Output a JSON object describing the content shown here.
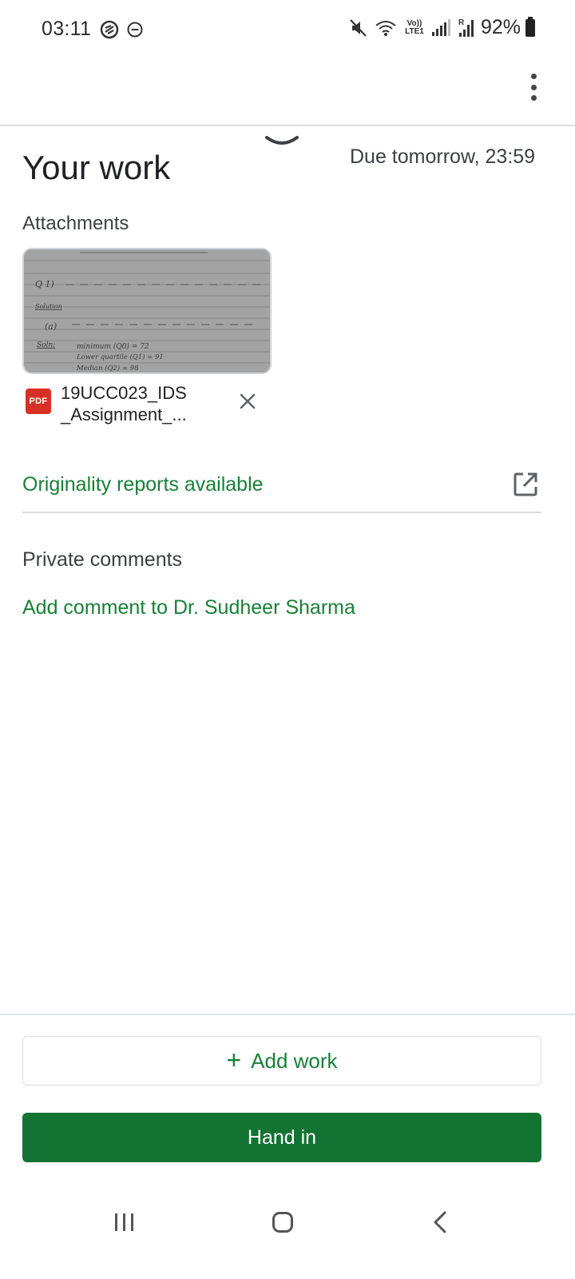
{
  "status_bar": {
    "time": "03:11",
    "battery_percent": "92%",
    "network_label": "Vo)) LTE1",
    "icons": [
      "vpn-shield-icon",
      "do-not-disturb-icon",
      "mute-icon",
      "wifi-icon",
      "signal-icon",
      "roaming-signal-icon",
      "battery-icon"
    ]
  },
  "app_bar": {
    "more_icon": "more-vert-icon"
  },
  "work": {
    "title": "Your work",
    "due": "Due tomorrow, 23:59",
    "attachments_label": "Attachments",
    "attachment": {
      "type_badge": "PDF",
      "file_name": "19UCC023_IDS _Assignment_...",
      "thumbnail_lines": [
        "Q 1)",
        "Solution",
        "(a)",
        "Soln:",
        "minimum (Q0) = 72",
        "Lower quartile (Q1) = 91",
        "Median (Q2) = 98"
      ]
    },
    "originality": "Originality reports available",
    "private_comments_label": "Private comments",
    "add_comment": "Add comment to Dr. Sudheer Sharma"
  },
  "actions": {
    "add_work_plus": "+",
    "add_work": "Add work",
    "hand_in": "Hand in"
  },
  "colors": {
    "accent_green": "#188038",
    "hand_in_green": "#137333",
    "pdf_red": "#d93025"
  }
}
